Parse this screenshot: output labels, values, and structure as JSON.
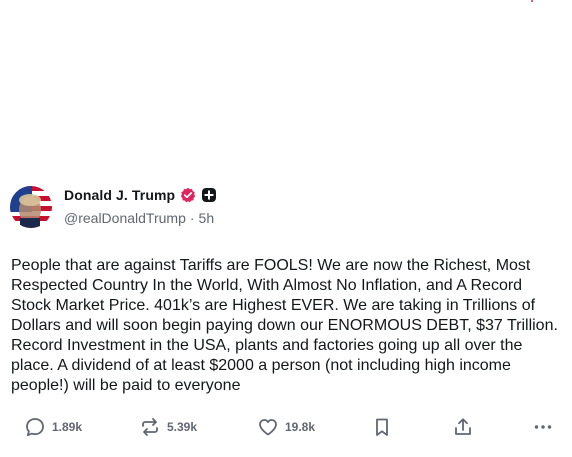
{
  "post": {
    "author": {
      "display_name": "Donald J. Trump",
      "handle": "@realDonaldTrump",
      "separator": "·",
      "time_ago": "5h"
    },
    "text": "People that are against Tariffs are FOOLS! We are now the Richest, Most Respected Country In the World, With Almost No Inflation, and A Record Stock Market Price. 401k’s are Highest EVER. We are taking in Trillions of Dollars and will soon begin paying down our ENORMOUS DEBT, $37 Trillion. Record Investment in the USA, plants and factories going up all over the place. A dividend of at least $2000 a person (not including high income people!) will be paid to everyone",
    "actions": {
      "replies": "1.89k",
      "reposts": "5.39k",
      "likes": "19.8k"
    }
  },
  "colors": {
    "verified_badge": "#e0245e",
    "icon_gray": "#606770",
    "text": "#14171a"
  },
  "icons": {
    "reply": "speech-bubble-icon",
    "repost": "repost-arrows-icon",
    "like": "heart-icon",
    "bookmark": "bookmark-icon",
    "share": "share-upload-icon",
    "more": "ellipsis-icon",
    "verified": "verified-badge-icon",
    "plus": "plus-badge-icon"
  }
}
